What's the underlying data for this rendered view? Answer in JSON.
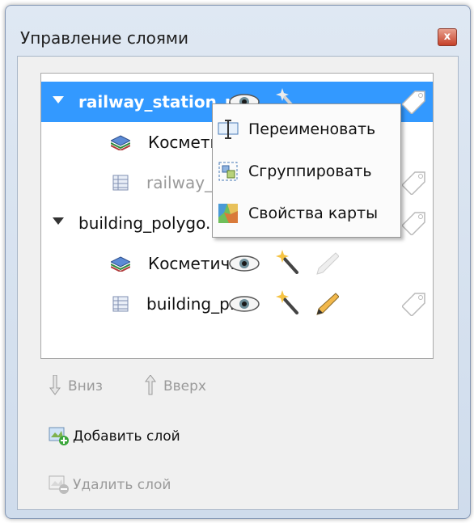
{
  "window": {
    "title": "Управление слоями",
    "close_glyph": "x"
  },
  "tree": {
    "rows": [
      {
        "label": "railway_station_p...",
        "selected": true,
        "expanded": true
      },
      {
        "label": "Косметич..."
      },
      {
        "label": "railway_..."
      },
      {
        "label": "building_polygo..."
      },
      {
        "label": "Косметич..."
      },
      {
        "label": "building_p..."
      }
    ]
  },
  "context_menu": {
    "items": [
      {
        "label": "Переименовать",
        "icon": "rename-icon"
      },
      {
        "label": "Сгруппировать",
        "icon": "group-icon"
      },
      {
        "label": "Свойства карты",
        "icon": "map-properties-icon"
      }
    ]
  },
  "toolbar": {
    "down_label": "Вниз",
    "up_label": "Вверх",
    "add_label": "Добавить слой",
    "remove_label": "Удалить слой"
  },
  "colors": {
    "selection": "#3399ff",
    "disabled_text": "#9a9a9a"
  }
}
